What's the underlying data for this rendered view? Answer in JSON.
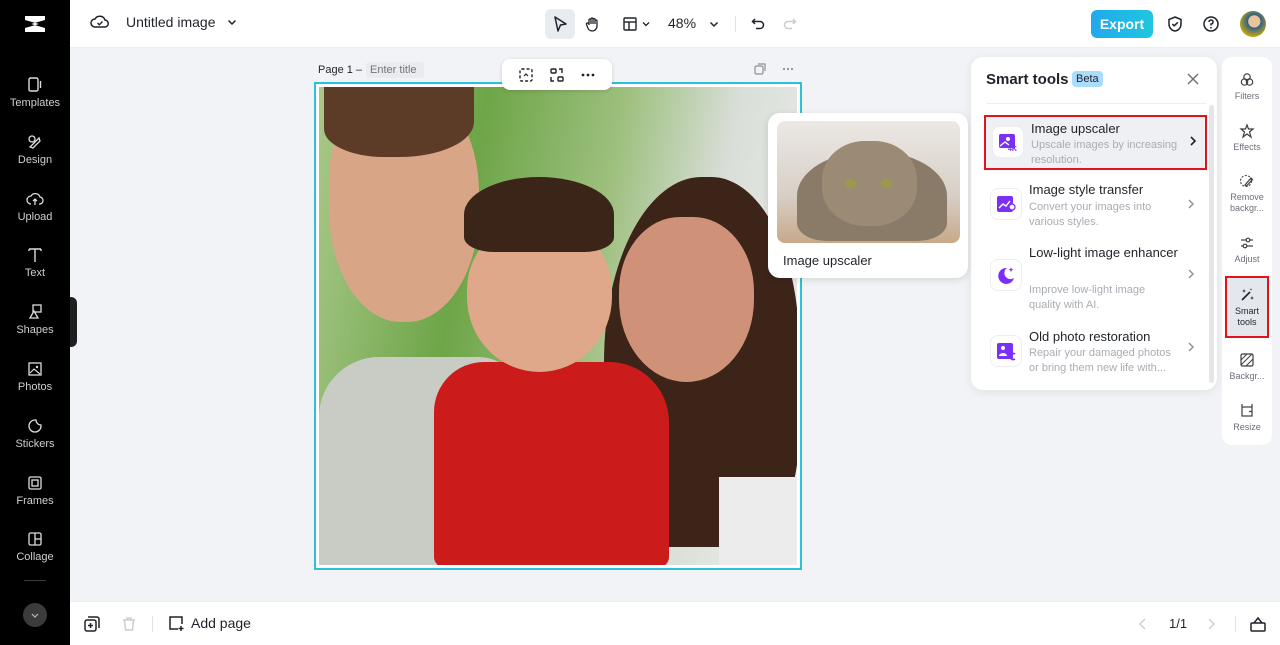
{
  "app": {
    "document_title": "Untitled image",
    "zoom_level": "48%",
    "export_label": "Export"
  },
  "sidebar": {
    "items": [
      {
        "label": "Templates",
        "icon": "templates-icon"
      },
      {
        "label": "Design",
        "icon": "design-icon"
      },
      {
        "label": "Upload",
        "icon": "upload-icon"
      },
      {
        "label": "Text",
        "icon": "text-icon"
      },
      {
        "label": "Shapes",
        "icon": "shapes-icon"
      },
      {
        "label": "Photos",
        "icon": "photos-icon"
      },
      {
        "label": "Stickers",
        "icon": "stickers-icon"
      },
      {
        "label": "Frames",
        "icon": "frames-icon"
      },
      {
        "label": "Collage",
        "icon": "collage-icon"
      }
    ]
  },
  "canvas": {
    "page_label": "Page 1 –",
    "page_title_placeholder": "Enter title",
    "selection_color": "#2bc1d6"
  },
  "preview_card": {
    "label": "Image upscaler"
  },
  "smart_tools": {
    "title": "Smart tools",
    "badge": "Beta",
    "items": [
      {
        "name": "Image upscaler",
        "description": "Upscale images by increasing resolution.",
        "selected": true
      },
      {
        "name": "Image style transfer",
        "description": "Convert your images into various styles.",
        "selected": false
      },
      {
        "name": "Low-light image enhancer",
        "description": "Improve low-light image quality with AI.",
        "selected": false
      },
      {
        "name": "Old photo restoration",
        "description": "Repair your damaged photos or bring them new life with...",
        "selected": false
      }
    ],
    "accent_color": "#7b2ff7",
    "highlight_color": "#e0141c"
  },
  "right_toolbar": {
    "items": [
      {
        "label": "Filters"
      },
      {
        "label": "Effects"
      },
      {
        "label": "Remove backgr..."
      },
      {
        "label": "Adjust"
      },
      {
        "label": "Smart tools",
        "selected": true
      },
      {
        "label": "Backgr..."
      },
      {
        "label": "Resize"
      }
    ]
  },
  "bottom_bar": {
    "add_page_label": "Add page",
    "page_counter": "1/1"
  }
}
